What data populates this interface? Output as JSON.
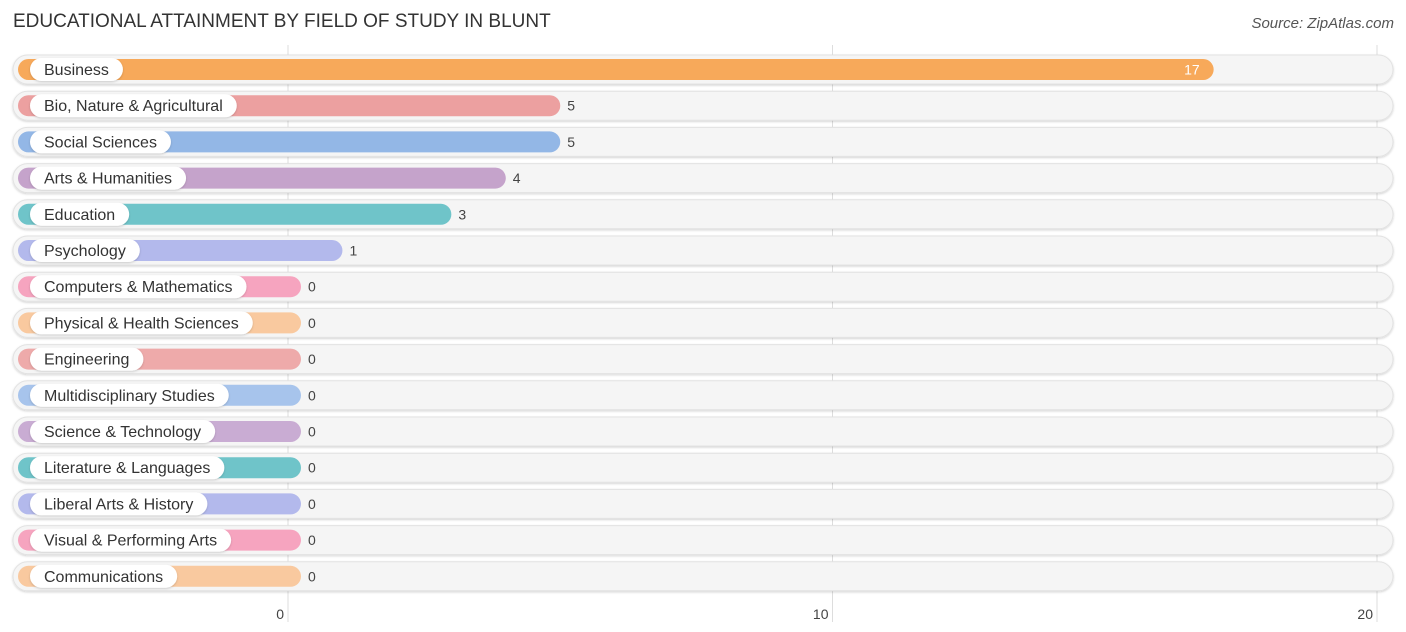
{
  "chart_data": {
    "type": "bar",
    "orientation": "horizontal",
    "title": "EDUCATIONAL ATTAINMENT BY FIELD OF STUDY IN BLUNT",
    "source": "Source: ZipAtlas.com",
    "xlabel": "",
    "ylabel": "",
    "xlim": [
      0,
      20
    ],
    "xticks": [
      "0",
      "10",
      "20"
    ],
    "grid": true,
    "categories": [
      "Business",
      "Bio, Nature & Agricultural",
      "Social Sciences",
      "Arts & Humanities",
      "Education",
      "Psychology",
      "Computers & Mathematics",
      "Physical & Health Sciences",
      "Engineering",
      "Multidisciplinary Studies",
      "Science & Technology",
      "Literature & Languages",
      "Liberal Arts & History",
      "Visual & Performing Arts",
      "Communications"
    ],
    "values": [
      17,
      5,
      5,
      4,
      3,
      1,
      0,
      0,
      0,
      0,
      0,
      0,
      0,
      0,
      0
    ],
    "colors": [
      "#f7a95a",
      "#eca0a0",
      "#93b7e6",
      "#c5a3cb",
      "#6fc4c9",
      "#b3b9ec",
      "#f6a4bf",
      "#f9c99f",
      "#eeaaaa",
      "#a7c4ec",
      "#c9acd3",
      "#6fc4c9",
      "#b3b9ec",
      "#f6a4bf",
      "#f9c99f"
    ]
  }
}
